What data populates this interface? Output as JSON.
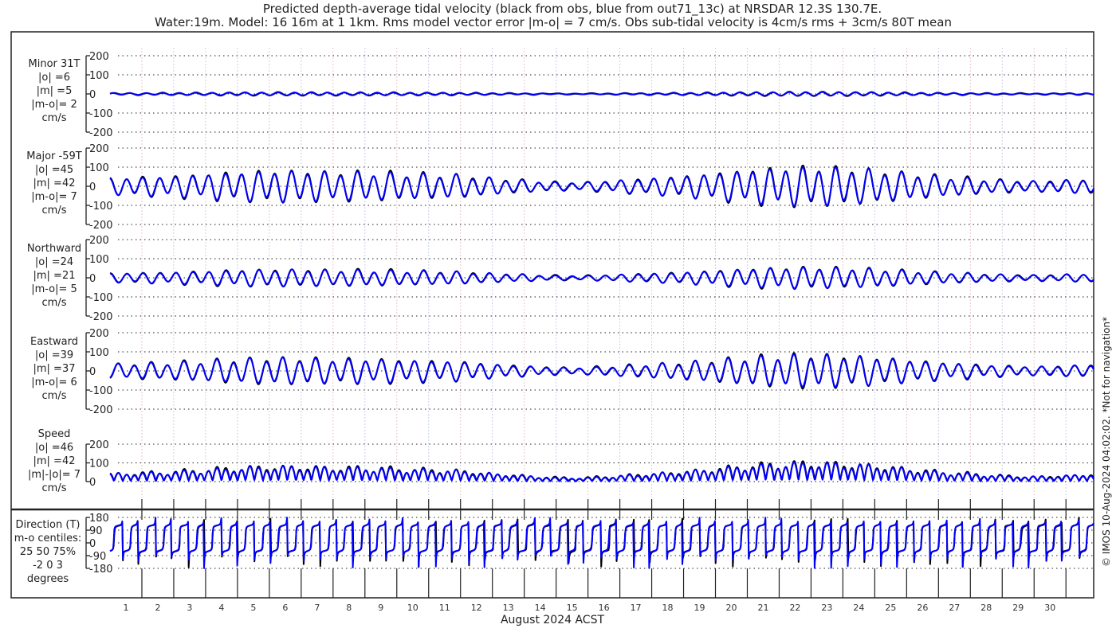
{
  "title_lines": [
    "Predicted depth-average tidal velocity (black from obs, blue from out71_13c) at NRSDAR 12.3S 130.7E.",
    "Water:19m. Model: 16 16m at 1 1km. Rms model vector error |m-o| = 7 cm/s. Obs sub-tidal velocity is 4cm/s rms + 3cm/s 80T mean"
  ],
  "side_note": "© IMOS 10-Aug-2024 04:02:02. *Not for navigation*",
  "colors": {
    "obs": "#000000",
    "model": "#0000ff",
    "grid": "#000000",
    "vgrid_a": "#e8c8c8",
    "vgrid_b": "#c8d0ec"
  },
  "chart_data": {
    "type": "line",
    "xlabel": "August 2024 ACST",
    "x_tick_labels": [
      "1",
      "2",
      "3",
      "4",
      "5",
      "6",
      "7",
      "8",
      "9",
      "10",
      "11",
      "12",
      "13",
      "14",
      "15",
      "16",
      "17",
      "18",
      "19",
      "20",
      "21",
      "22",
      "23",
      "24",
      "25",
      "26",
      "27",
      "28",
      "29",
      "30"
    ],
    "x_range_days": [
      0,
      30.87
    ],
    "series_names": [
      "obs",
      "model"
    ],
    "major_axis_daily_amplitude_cm_s": [
      40,
      45,
      50,
      60,
      70,
      75,
      75,
      70,
      70,
      65,
      60,
      55,
      40,
      30,
      20,
      20,
      30,
      40,
      50,
      65,
      80,
      90,
      95,
      90,
      80,
      65,
      50,
      40,
      30,
      25,
      30,
      40
    ],
    "tidal_period_days": 0.5175,
    "panels": [
      {
        "key": "minor",
        "label": [
          "Minor 31T",
          "|o| =6",
          "|m| =5",
          "|m-o|= 2",
          "cm/s"
        ],
        "ylim": [
          -200,
          200
        ],
        "ticks": [
          "200",
          "100",
          "0",
          "-100",
          "-200"
        ],
        "obs_rms": 6,
        "model_rms": 5,
        "err_rms": 2
      },
      {
        "key": "major",
        "label": [
          "Major -59T",
          "|o| =45",
          "|m| =42",
          "|m-o|= 7",
          "cm/s"
        ],
        "ylim": [
          -200,
          200
        ],
        "ticks": [
          "200",
          "100",
          "0",
          "-100",
          "-200"
        ],
        "obs_rms": 45,
        "model_rms": 42,
        "err_rms": 7
      },
      {
        "key": "north",
        "label": [
          "Northward",
          "|o| =24",
          "|m| =21",
          "|m-o|= 5",
          "cm/s"
        ],
        "ylim": [
          -200,
          200
        ],
        "ticks": [
          "200",
          "100",
          "0",
          "-100",
          "-200"
        ],
        "obs_rms": 24,
        "model_rms": 21,
        "err_rms": 5
      },
      {
        "key": "east",
        "label": [
          "Eastward",
          "|o| =39",
          "|m| =37",
          "|m-o|= 6",
          "cm/s"
        ],
        "ylim": [
          -200,
          200
        ],
        "ticks": [
          "200",
          "100",
          "0",
          "-100",
          "-200"
        ],
        "obs_rms": 39,
        "model_rms": 37,
        "err_rms": 6
      },
      {
        "key": "speed",
        "label": [
          "Speed",
          "|o| =46",
          "|m| =42",
          "|m|-|o|= 7",
          "cm/s"
        ],
        "ylim": [
          0,
          200
        ],
        "ticks": [
          "200",
          "100",
          "0"
        ],
        "obs_rms": 46,
        "model_rms": 42,
        "err_rms": 7
      },
      {
        "key": "direction",
        "label": [
          "Direction (T)",
          "m-o centiles:",
          "25  50  75%",
          "-2  0  3",
          "degrees"
        ],
        "ylim": [
          -180,
          180
        ],
        "ticks": [
          "180",
          "90",
          "0",
          "-90",
          "-180"
        ],
        "centiles": [
          -2,
          0,
          3
        ]
      }
    ]
  }
}
